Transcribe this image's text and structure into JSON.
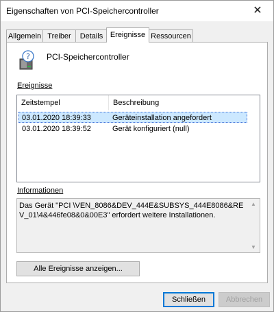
{
  "window": {
    "title": "Eigenschaften von PCI-Speichercontroller",
    "close_glyph": "✕"
  },
  "tabs": [
    {
      "label": "Allgemein"
    },
    {
      "label": "Treiber"
    },
    {
      "label": "Details"
    },
    {
      "label": "Ereignisse",
      "active": true
    },
    {
      "label": "Ressourcen"
    }
  ],
  "device": {
    "name": "PCI-Speichercontroller",
    "icon": "unknown-device-icon"
  },
  "events": {
    "label": "Ereignisse",
    "columns": [
      "Zeitstempel",
      "Beschreibung"
    ],
    "rows": [
      {
        "timestamp": "03.01.2020 18:39:33",
        "description": "Geräteinstallation angefordert",
        "selected": true
      },
      {
        "timestamp": "03.01.2020 18:39:52",
        "description": "Gerät konfiguriert (null)",
        "selected": false
      }
    ]
  },
  "info": {
    "label": "Informationen",
    "text": "Das Gerät \"PCI \\VEN_8086&DEV_444E&SUBSYS_444E8086&REV_01\\4&446fe08&0&00E3\" erfordert weitere Installationen."
  },
  "buttons": {
    "show_all": "Alle Ereignisse anzeigen...",
    "close": "Schließen",
    "cancel": "Abbrechen"
  },
  "colors": {
    "selection": "#cce8ff",
    "focus": "#0078d7"
  }
}
